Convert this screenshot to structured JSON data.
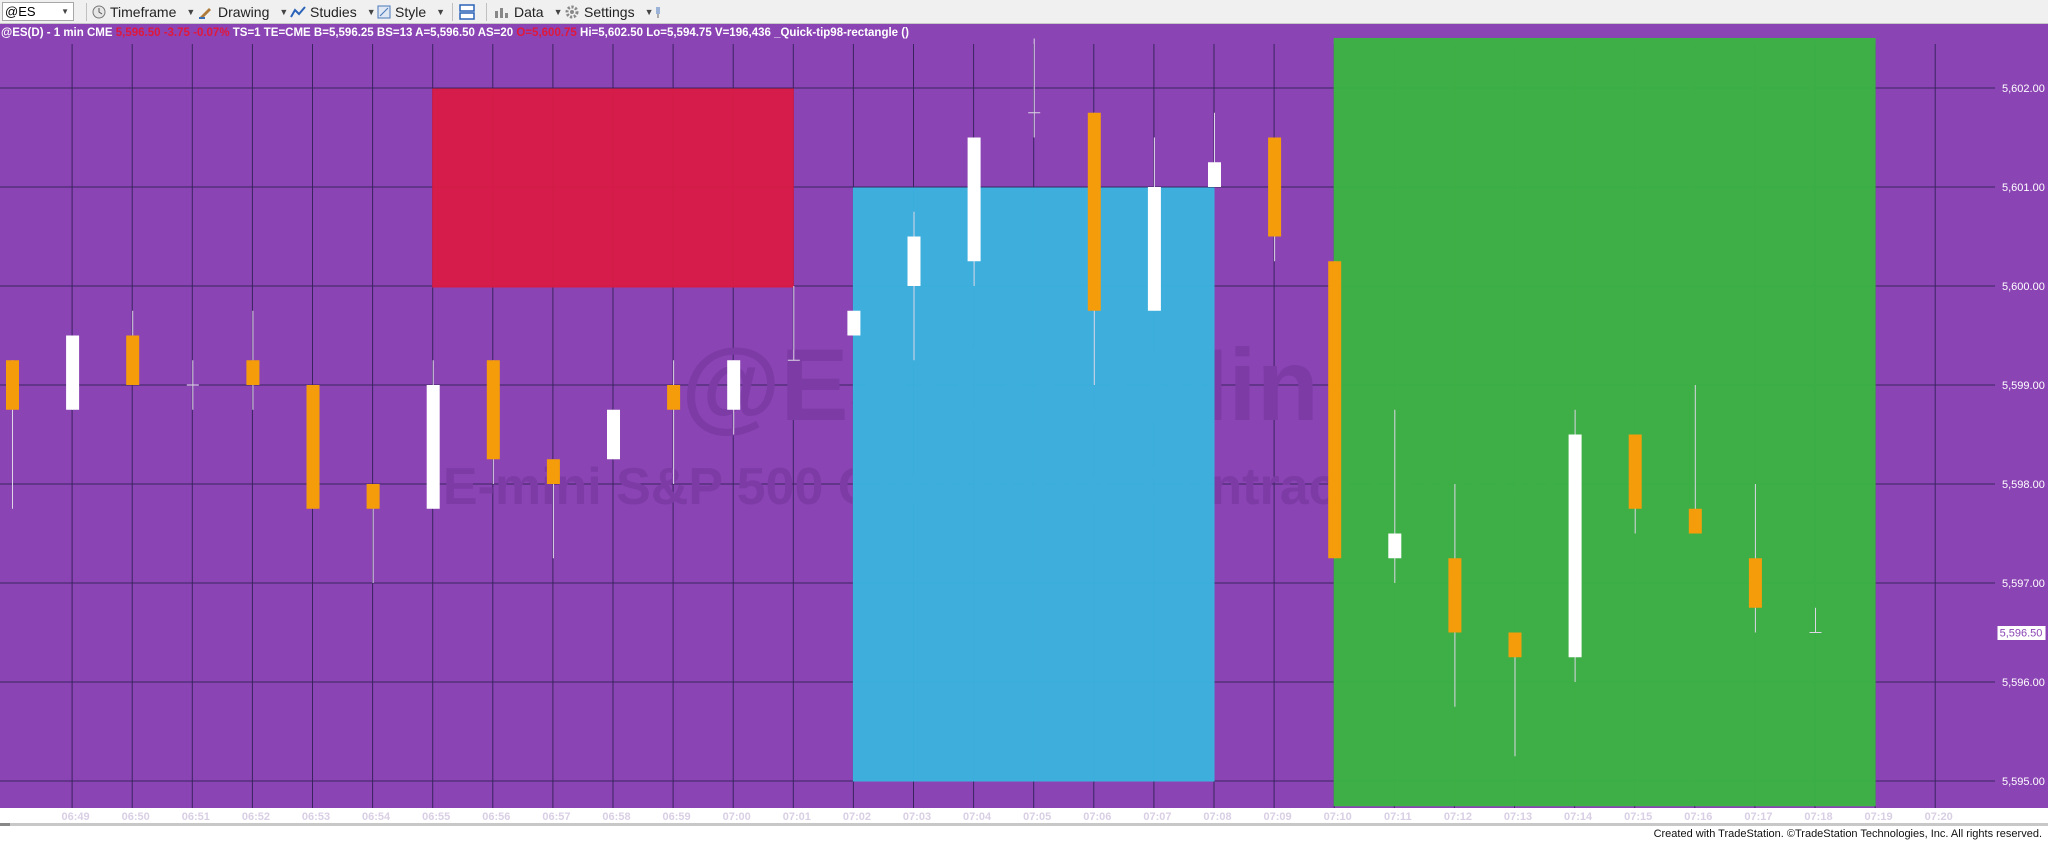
{
  "toolbar": {
    "symbol": "@ES",
    "timeframe": "Timeframe",
    "drawing": "Drawing",
    "studies": "Studies",
    "style": "Style",
    "data": "Data",
    "settings": "Settings"
  },
  "status_line": {
    "title": "@ES(D) - 1 min  CME",
    "last": "5,596.50",
    "change": "-3.75",
    "pct": "-0.07%",
    "ts": "TS=1  TE=CME  B=5,596.25  BS=13  A=5,596.50  AS=20",
    "open": "O=5,600.75",
    "hilo": "Hi=5,602.50  Lo=5,594.75  V=196,436  _Quick-tip98-rectangle ()"
  },
  "watermark": {
    "symbol": "@ES(D),1Min",
    "description": "E-mini S&P 500 Continuous Contract [Sep24]"
  },
  "last_price_label": "5,596.50",
  "credit": "Created with TradeStation. ©TradeStation Technologies, Inc. All rights reserved.",
  "colors": {
    "background": "#8b44b4",
    "grid": "#3a2460",
    "up_candle": "#ffffff",
    "down_candle": "#f59c0b",
    "rect_red": "#d81b46",
    "rect_blue": "#3bb3df",
    "rect_green": "#3bb443"
  },
  "chart_data": {
    "type": "candlestick",
    "x": [
      "06:48",
      "06:49",
      "06:50",
      "06:51",
      "06:52",
      "06:53",
      "06:54",
      "06:55",
      "06:56",
      "06:57",
      "06:58",
      "06:59",
      "07:00",
      "07:01",
      "07:02",
      "07:03",
      "07:04",
      "07:05",
      "07:06",
      "07:07",
      "07:08",
      "07:09",
      "07:10",
      "07:11",
      "07:12",
      "07:13",
      "07:14",
      "07:15",
      "07:16",
      "07:17",
      "07:18"
    ],
    "x_tick_labels": [
      "06:49",
      "06:50",
      "06:51",
      "06:52",
      "06:53",
      "06:54",
      "06:55",
      "06:56",
      "06:57",
      "06:58",
      "06:59",
      "07:00",
      "07:01",
      "07:02",
      "07:03",
      "07:04",
      "07:05",
      "07:06",
      "07:07",
      "07:08",
      "07:09",
      "07:10",
      "07:11",
      "07:12",
      "07:13",
      "07:14",
      "07:15",
      "07:16",
      "07:17",
      "07:18",
      "07:19",
      "07:20"
    ],
    "y_tick_labels": [
      "5,602.00",
      "5,601.00",
      "5,600.00",
      "5,599.00",
      "5,598.00",
      "5,597.00",
      "5,596.00",
      "5,595.00"
    ],
    "ylim": [
      5594.7,
      5602.6
    ],
    "candles": [
      {
        "o": 5599.25,
        "h": 5599.25,
        "l": 5597.75,
        "c": 5598.75
      },
      {
        "o": 5598.75,
        "h": 5599.5,
        "l": 5598.75,
        "c": 5599.5
      },
      {
        "o": 5599.5,
        "h": 5599.75,
        "l": 5599.0,
        "c": 5599.0
      },
      {
        "o": 5599.0,
        "h": 5599.25,
        "l": 5598.75,
        "c": 5599.0
      },
      {
        "o": 5599.25,
        "h": 5599.75,
        "l": 5598.75,
        "c": 5599.0
      },
      {
        "o": 5599.0,
        "h": 5599.0,
        "l": 5597.75,
        "c": 5597.75
      },
      {
        "o": 5598.0,
        "h": 5598.0,
        "l": 5597.0,
        "c": 5597.75
      },
      {
        "o": 5597.75,
        "h": 5599.25,
        "l": 5597.75,
        "c": 5599.0
      },
      {
        "o": 5599.25,
        "h": 5599.25,
        "l": 5598.0,
        "c": 5598.25
      },
      {
        "o": 5598.25,
        "h": 5598.25,
        "l": 5597.25,
        "c": 5598.0
      },
      {
        "o": 5598.25,
        "h": 5598.75,
        "l": 5598.25,
        "c": 5598.75
      },
      {
        "o": 5599.0,
        "h": 5599.25,
        "l": 5598.0,
        "c": 5598.75
      },
      {
        "o": 5598.75,
        "h": 5599.25,
        "l": 5598.5,
        "c": 5599.25
      },
      {
        "o": 5599.25,
        "h": 5600.0,
        "l": 5599.25,
        "c": 5599.25
      },
      {
        "o": 5599.5,
        "h": 5599.75,
        "l": 5599.5,
        "c": 5599.75
      },
      {
        "o": 5600.0,
        "h": 5600.75,
        "l": 5599.25,
        "c": 5600.5
      },
      {
        "o": 5600.25,
        "h": 5601.5,
        "l": 5600.0,
        "c": 5601.5
      },
      {
        "o": 5601.75,
        "h": 5602.5,
        "l": 5601.5,
        "c": 5601.75
      },
      {
        "o": 5601.75,
        "h": 5601.75,
        "l": 5599.0,
        "c": 5599.75
      },
      {
        "o": 5599.75,
        "h": 5601.5,
        "l": 5599.75,
        "c": 5601.0
      },
      {
        "o": 5601.0,
        "h": 5601.75,
        "l": 5601.0,
        "c": 5601.25
      },
      {
        "o": 5601.5,
        "h": 5601.5,
        "l": 5600.25,
        "c": 5600.5
      },
      {
        "o": 5600.25,
        "h": 5600.25,
        "l": 5597.25,
        "c": 5597.25
      },
      {
        "o": 5597.25,
        "h": 5598.75,
        "l": 5597.0,
        "c": 5597.5
      },
      {
        "o": 5597.25,
        "h": 5598.0,
        "l": 5595.75,
        "c": 5596.5
      },
      {
        "o": 5596.5,
        "h": 5596.5,
        "l": 5595.25,
        "c": 5596.25
      },
      {
        "o": 5596.25,
        "h": 5598.75,
        "l": 5596.0,
        "c": 5598.5
      },
      {
        "o": 5598.5,
        "h": 5598.5,
        "l": 5597.5,
        "c": 5597.75
      },
      {
        "o": 5597.75,
        "h": 5599.0,
        "l": 5597.5,
        "c": 5597.5
      },
      {
        "o": 5597.25,
        "h": 5598.0,
        "l": 5596.5,
        "c": 5596.75
      },
      {
        "o": 5596.5,
        "h": 5596.75,
        "l": 5596.5,
        "c": 5596.5
      }
    ],
    "rectangles": [
      {
        "name": "red-rectangle",
        "from": "06:55",
        "to": "07:01",
        "top": 5601.99,
        "bottom": 5599.99
      },
      {
        "name": "blue-rectangle",
        "from": "07:02",
        "to": "07:08",
        "top": 5600.99,
        "bottom": 5595.0
      },
      {
        "name": "green-rectangle",
        "from": "07:10",
        "to": "07:19",
        "top": 5602.5,
        "bottom": 5594.75
      }
    ],
    "grid": true
  }
}
